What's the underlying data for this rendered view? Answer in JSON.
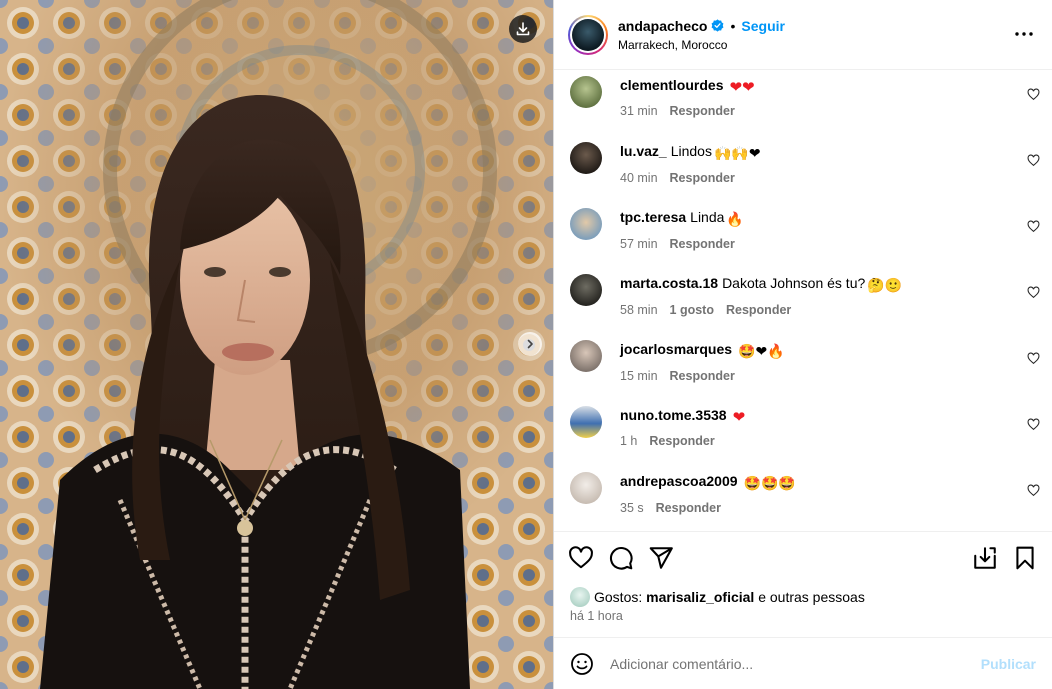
{
  "header": {
    "username": "andapacheco",
    "separator": "•",
    "follow_label": "Seguir",
    "location": "Marrakech, Morocco"
  },
  "comments": [
    {
      "user": "clementlourdes",
      "text": "",
      "emoji": "❤❤",
      "time": "31 min",
      "likes": "",
      "reply": "Responder",
      "avatar_color": "#7d8f5a"
    },
    {
      "user": "lu.vaz_",
      "text": "Lindos",
      "emoji": "🙌🙌❤",
      "time": "40 min",
      "likes": "",
      "reply": "Responder",
      "avatar_color": "#2b2622"
    },
    {
      "user": "tpc.teresa",
      "text": "Linda",
      "emoji": "🔥",
      "time": "57 min",
      "likes": "",
      "reply": "Responder",
      "avatar_color": "#8aa6bd"
    },
    {
      "user": "marta.costa.18",
      "text": "Dakota Johnson és tu?",
      "emoji": "🤔🙂",
      "time": "58 min",
      "likes": "1 gosto",
      "reply": "Responder",
      "avatar_color": "#3b3a34"
    },
    {
      "user": "jocarlosmarques",
      "text": "",
      "emoji": "🤩❤🔥",
      "time": "15 min",
      "likes": "",
      "reply": "Responder",
      "avatar_color": "#9a8f88"
    },
    {
      "user": "nuno.tome.3538",
      "text": "",
      "emoji": "❤",
      "time": "1 h",
      "likes": "",
      "reply": "Responder",
      "avatar_color": "#3f6fb0"
    },
    {
      "user": "andrepascoa2009",
      "text": "",
      "emoji": "🤩🤩🤩",
      "time": "35 s",
      "reply": "Responder",
      "likes": "",
      "avatar_color": "#d9d3cc"
    }
  ],
  "likes": {
    "prefix": "Gostos:",
    "user": "marisaliz_oficial",
    "suffix": "e outras pessoas"
  },
  "time_ago": "há 1 hora",
  "add_comment": {
    "placeholder": "Adicionar comentário...",
    "publish_label": "Publicar"
  },
  "colors": {
    "accent": "#0095f6",
    "publish_disabled": "#b2dffc",
    "meta_gray": "#737373",
    "heart_red": "#ed1c24"
  },
  "icons": {
    "download": "download-icon",
    "next": "chevron-right-icon",
    "verified": "verified-badge-icon",
    "more": "more-options-icon",
    "like": "heart-icon",
    "comment": "comment-icon",
    "share": "paper-plane-icon",
    "save_collection": "save-to-collection-icon",
    "bookmark": "bookmark-icon",
    "emoji": "smile-icon"
  }
}
